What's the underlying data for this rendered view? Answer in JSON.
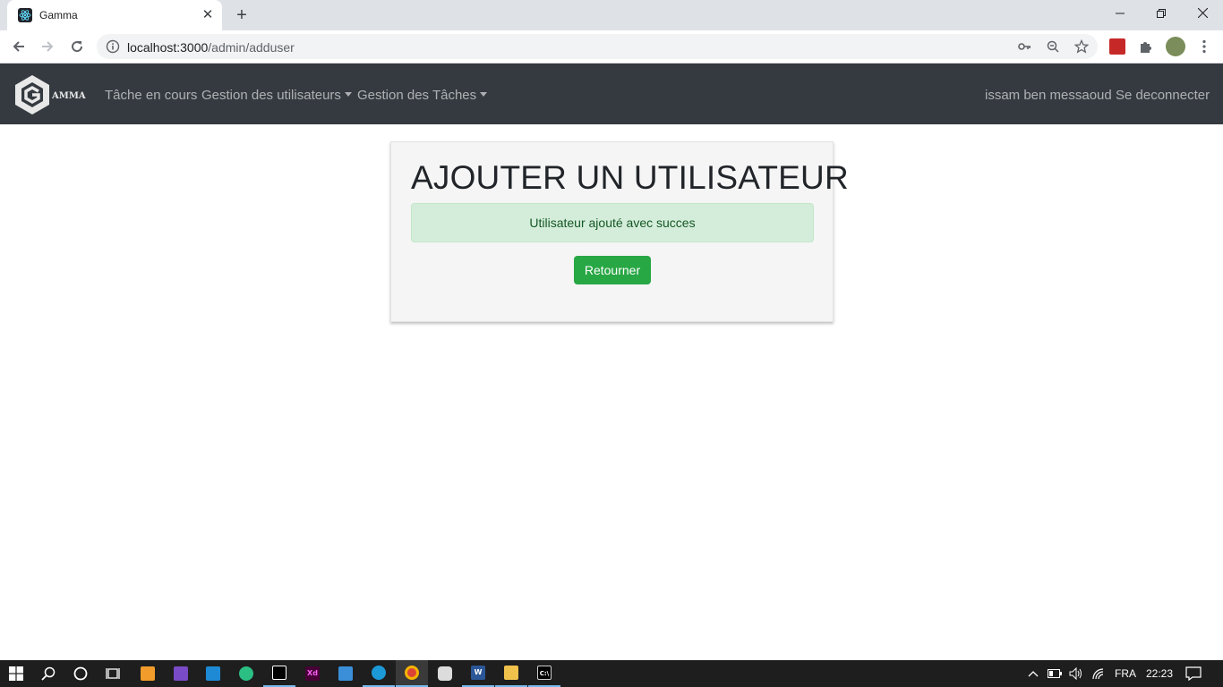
{
  "browser": {
    "tab_title": "Gamma",
    "tab_close": "✕",
    "new_tab": "+",
    "url_host": "localhost:3000",
    "url_path": "/admin/adduser"
  },
  "navbar": {
    "brand_text": "AMMA",
    "links": {
      "current_tasks": "Tâche en cours",
      "user_management": "Gestion des utilisateurs",
      "task_management": "Gestion des Tâches"
    },
    "user_name": "issam ben messaoud",
    "logout": "Se deconnecter"
  },
  "card": {
    "title": "AJOUTER UN UTILISATEUR",
    "alert_message": "Utilisateur ajouté avec succes",
    "back_button": "Retourner"
  },
  "taskbar": {
    "language": "FRA",
    "time": "22:23"
  },
  "colors": {
    "navbar_bg": "#343a40",
    "success": "#28a745",
    "alert_bg": "#d4edda",
    "alert_text": "#155724"
  }
}
